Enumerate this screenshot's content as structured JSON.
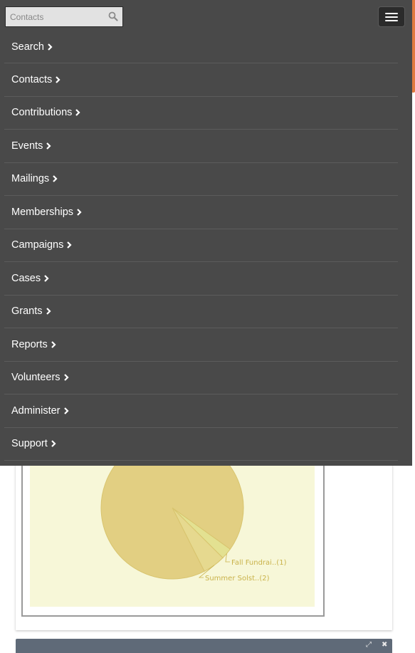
{
  "search": {
    "placeholder": "Contacts"
  },
  "menu": {
    "items": [
      {
        "label": "Search"
      },
      {
        "label": "Contacts"
      },
      {
        "label": "Contributions"
      },
      {
        "label": "Events"
      },
      {
        "label": "Mailings"
      },
      {
        "label": "Memberships"
      },
      {
        "label": "Campaigns"
      },
      {
        "label": "Cases"
      },
      {
        "label": "Grants"
      },
      {
        "label": "Reports"
      },
      {
        "label": "Volunteers"
      },
      {
        "label": "Administer"
      },
      {
        "label": "Support"
      }
    ]
  },
  "chart_data": {
    "type": "pie",
    "slices": [
      {
        "label": "",
        "value": 36,
        "color": "#e2cf82"
      },
      {
        "label": "Fall Fundrai..(1)",
        "value": 1,
        "color": "#e3e191"
      },
      {
        "label": "Summer Solst..(2)",
        "value": 2,
        "color": "#e6d98f"
      }
    ],
    "label_color": "#c9b24a"
  },
  "widget": {
    "controls": [
      "⤢",
      "✖"
    ]
  }
}
